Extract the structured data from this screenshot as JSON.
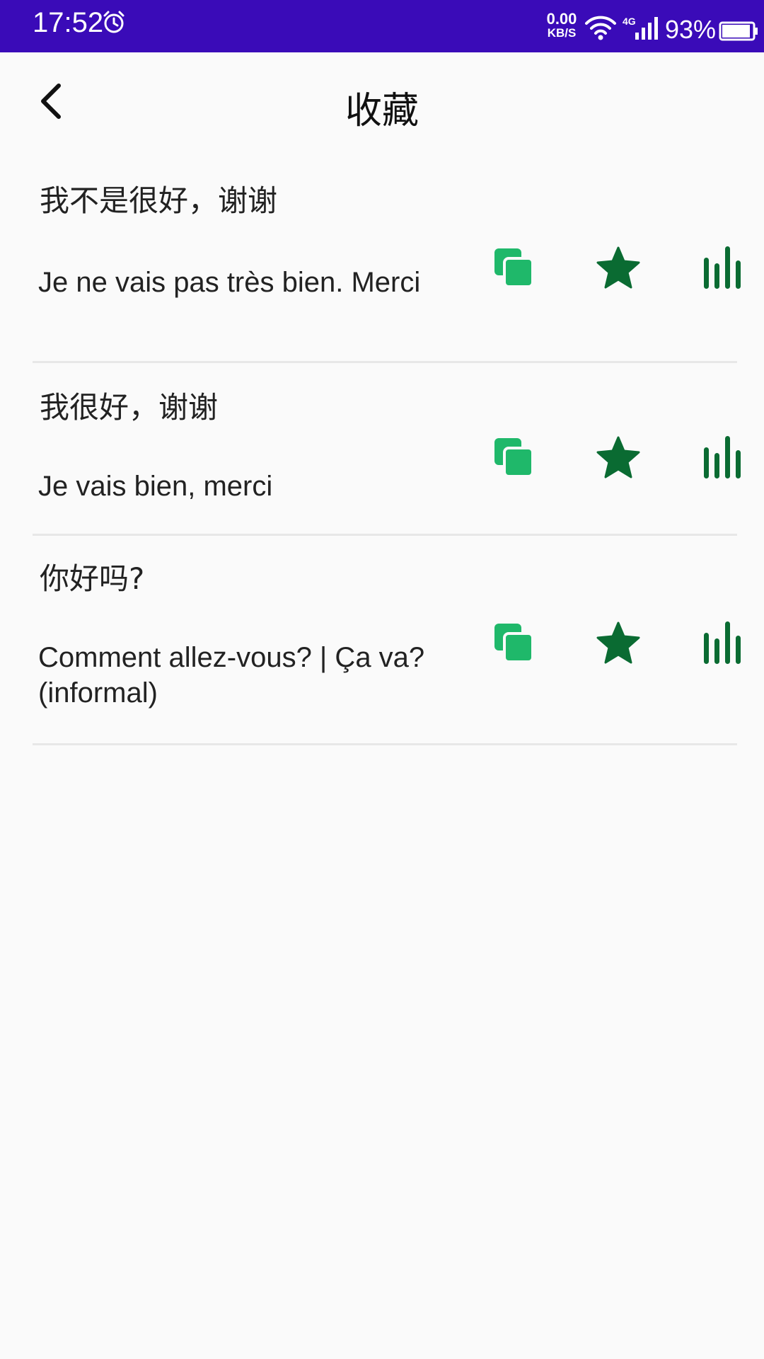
{
  "status_bar": {
    "time": "17:52",
    "net_speed_value": "0.00",
    "net_speed_unit": "KB/S",
    "network_type": "4G",
    "battery": "93%",
    "battery_level": 0.93,
    "background_color": "#3a0bb8"
  },
  "header": {
    "title": "收藏",
    "back_icon": "chevron-left-icon"
  },
  "accent_colors": {
    "copy": "#1fb86a",
    "favorite": "#0a6b32",
    "audio": "#0a6b32"
  },
  "favorites": [
    {
      "source": "我不是很好，谢谢",
      "translation": "Je ne vais pas très bien. Merci",
      "icons": [
        "copy-icon",
        "star-icon",
        "audio-bars-icon"
      ]
    },
    {
      "source": "我很好，谢谢",
      "translation": "Je vais bien, merci",
      "icons": [
        "copy-icon",
        "star-icon",
        "audio-bars-icon"
      ]
    },
    {
      "source": "你好吗?",
      "translation": "Comment allez-vous? | Ça va? (informal)",
      "icons": [
        "copy-icon",
        "star-icon",
        "audio-bars-icon"
      ]
    }
  ]
}
